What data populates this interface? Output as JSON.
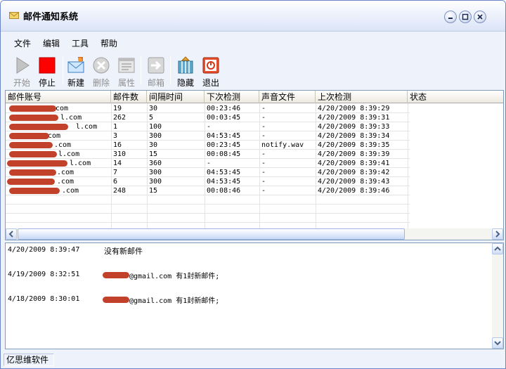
{
  "window": {
    "title": "邮件通知系统"
  },
  "menu": [
    "文件",
    "编辑",
    "工具",
    "帮助"
  ],
  "toolbar": [
    {
      "label": "开始",
      "icon": "play-icon",
      "enabled": false
    },
    {
      "label": "停止",
      "icon": "stop-icon",
      "enabled": true
    },
    {
      "label": "新建",
      "icon": "new-mail-icon",
      "enabled": true
    },
    {
      "label": "删除",
      "icon": "delete-icon",
      "enabled": false
    },
    {
      "label": "属性",
      "icon": "properties-icon",
      "enabled": false
    },
    {
      "label": "邮箱",
      "icon": "mailbox-arrow-icon",
      "enabled": false
    },
    {
      "label": "隐藏",
      "icon": "hide-icon",
      "enabled": true
    },
    {
      "label": "退出",
      "icon": "exit-icon",
      "enabled": true
    }
  ],
  "grid": {
    "columns": [
      "邮件账号",
      "邮件数",
      "间隔时间",
      "下次检测",
      "声音文件",
      "上次检测",
      "状态"
    ],
    "rows": [
      {
        "account": "   .com",
        "count": "19",
        "interval": "30",
        "next": "00:23:46",
        "sound": "-",
        "last": "4/20/2009 8:39:29"
      },
      {
        "account": "l.com",
        "count": "262",
        "interval": "5",
        "next": "00:03:45",
        "sound": "-",
        "last": "4/20/2009 8:39:31"
      },
      {
        "account": "l.com",
        "count": "1",
        "interval": "100",
        "next": "-",
        "sound": "-",
        "last": "4/20/2009 8:39:33"
      },
      {
        "account": "com",
        "count": "3",
        "interval": "300",
        "next": "04:53:45",
        "sound": "-",
        "last": "4/20/2009 8:39:34"
      },
      {
        "account": ".com",
        "count": "16",
        "interval": "30",
        "next": "00:23:45",
        "sound": "notify.wav",
        "last": "4/20/2009 8:39:35"
      },
      {
        "account": "l.com",
        "count": "310",
        "interval": "15",
        "next": "00:08:45",
        "sound": "-",
        "last": "4/20/2009 8:39:39"
      },
      {
        "account": "l.com",
        "count": "14",
        "interval": "360",
        "next": "-",
        "sound": "-",
        "last": "4/20/2009 8:39:41"
      },
      {
        "account": ".com",
        "count": "7",
        "interval": "300",
        "next": "04:53:45",
        "sound": "-",
        "last": "4/20/2009 8:39:42"
      },
      {
        "account": ".com",
        "count": "6",
        "interval": "300",
        "next": "04:53:45",
        "sound": "-",
        "last": "4/20/2009 8:39:43"
      },
      {
        "account": ".com",
        "count": "248",
        "interval": "15",
        "next": "00:08:46",
        "sound": "-",
        "last": "4/20/2009 8:39:46"
      }
    ]
  },
  "log": [
    {
      "time": "4/20/2009 8:39:47",
      "message": "没有新邮件"
    },
    {
      "time": "4/19/2009 8:32:51",
      "message": "@gmail.com 有1封新邮件;"
    },
    {
      "time": "4/18/2009 8:30:01",
      "message": "@gmail.com 有1封新邮件;"
    }
  ],
  "status": {
    "text": "亿思维软件"
  },
  "colors": {
    "redaction": "#c2412b",
    "border": "#7f9db9",
    "frame": "#6b86c8"
  }
}
